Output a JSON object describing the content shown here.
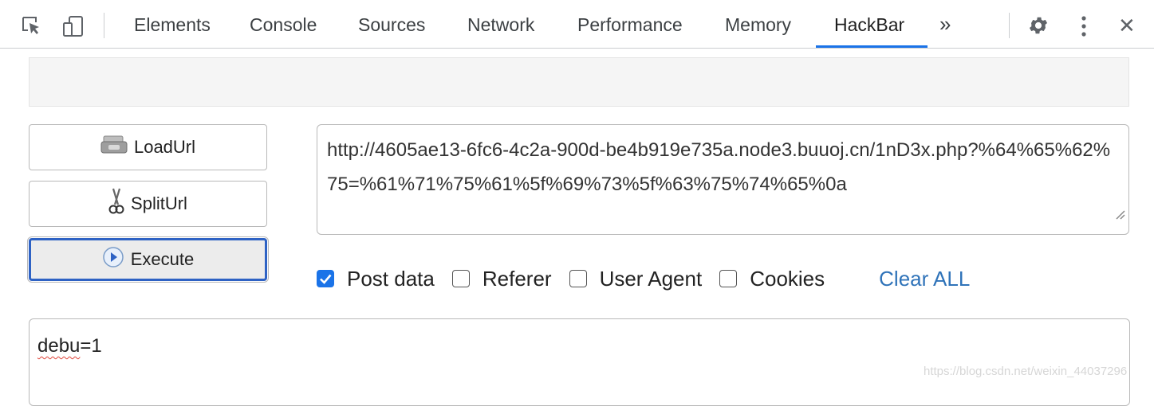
{
  "devtools": {
    "tabs": [
      {
        "label": "Elements"
      },
      {
        "label": "Console"
      },
      {
        "label": "Sources"
      },
      {
        "label": "Network"
      },
      {
        "label": "Performance"
      },
      {
        "label": "Memory"
      },
      {
        "label": "HackBar",
        "active": true
      }
    ],
    "more_tabs_label": "»",
    "close_label": "✕",
    "accent_color": "#1a73e8"
  },
  "hackbar": {
    "buttons": {
      "load": "LoadUrl",
      "split": "SplitUrl",
      "execute": "Execute"
    },
    "url_value": "http://4605ae13-6fc6-4c2a-900d-be4b919e735a.node3.buuoj.cn/1nD3x.php?%64%65%62%75=%61%71%75%61%5f%69%73%5f%63%75%74%65%0a",
    "options": {
      "post_data": {
        "label": "Post data",
        "checked": true
      },
      "referer": {
        "label": "Referer",
        "checked": false
      },
      "user_agent": {
        "label": "User Agent",
        "checked": false
      },
      "cookies": {
        "label": "Cookies",
        "checked": false
      }
    },
    "clear_all": "Clear ALL",
    "post_value_key": "debu",
    "post_value_rest": "=1"
  },
  "watermark": "https://blog.csdn.net/weixin_44037296"
}
